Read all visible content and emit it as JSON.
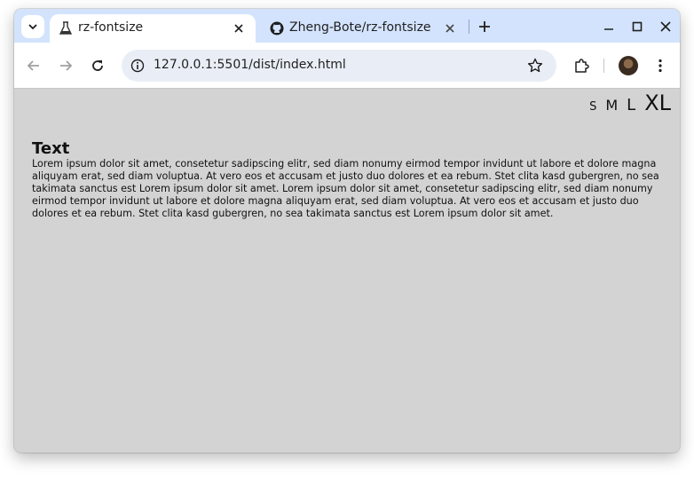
{
  "browser": {
    "tabs": [
      {
        "title": "rz-fontsize",
        "favicon": "flask-icon",
        "active": true
      },
      {
        "title": "Zheng-Bote/rz-fontsize",
        "favicon": "github-icon",
        "active": false
      }
    ],
    "address": "127.0.0.1:5501/dist/index.html"
  },
  "page": {
    "font_sizes": [
      "S",
      "M",
      "L",
      "XL"
    ],
    "heading": "Text",
    "body": "Lorem ipsum dolor sit amet, consetetur sadipscing elitr, sed diam nonumy eirmod tempor invidunt ut labore et dolore magna aliquyam erat, sed diam voluptua. At vero eos et accusam et justo duo dolores et ea rebum. Stet clita kasd gubergren, no sea takimata sanctus est Lorem ipsum dolor sit amet. Lorem ipsum dolor sit amet, consetetur sadipscing elitr, sed diam nonumy eirmod tempor invidunt ut labore et dolore magna aliquyam erat, sed diam voluptua. At vero eos et accusam et justo duo dolores et ea rebum. Stet clita kasd gubergren, no sea takimata sanctus est Lorem ipsum dolor sit amet."
  },
  "colors": {
    "tabstrip": "#d3e3fd",
    "page_background": "#d3d3d3",
    "omnibox": "#e9eef6"
  }
}
